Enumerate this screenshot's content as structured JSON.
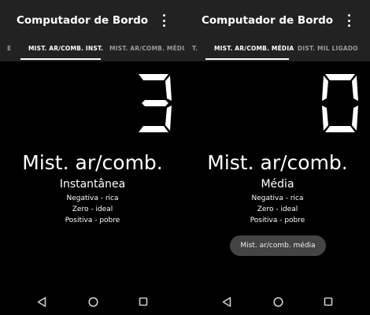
{
  "app": {
    "title": "Computador de Bordo"
  },
  "left": {
    "tabs": [
      {
        "label": "E"
      },
      {
        "label": "MIST. AR/COMB. INST."
      },
      {
        "label": "MIST. AR/COMB. MÉDIA"
      }
    ],
    "digit": "3",
    "main_label": "Mist. ar/comb.",
    "sub_label": "Instantânea",
    "legend": [
      "Negativa - rica",
      "Zero - ideal",
      "Positiva - pobre"
    ]
  },
  "right": {
    "tabs": [
      {
        "label": "T."
      },
      {
        "label": "MIST. AR/COMB. MÉDIA"
      },
      {
        "label": "DIST. MIL LIGADO"
      }
    ],
    "digit": "0",
    "main_label": "Mist. ar/comb.",
    "sub_label": "Média",
    "legend": [
      "Negativa - rica",
      "Zero - ideal",
      "Positiva - pobre"
    ],
    "toast": "Mist. ar/comb. média"
  },
  "colors": {
    "appbar": "#222222",
    "background": "#000000",
    "text": "#ffffff",
    "tab_inactive": "#9a9a9a",
    "toast": "#444444"
  },
  "icons": {
    "overflow": "more-vert-icon",
    "back": "back-triangle-icon",
    "home": "home-circle-icon",
    "recents": "recents-square-icon"
  }
}
